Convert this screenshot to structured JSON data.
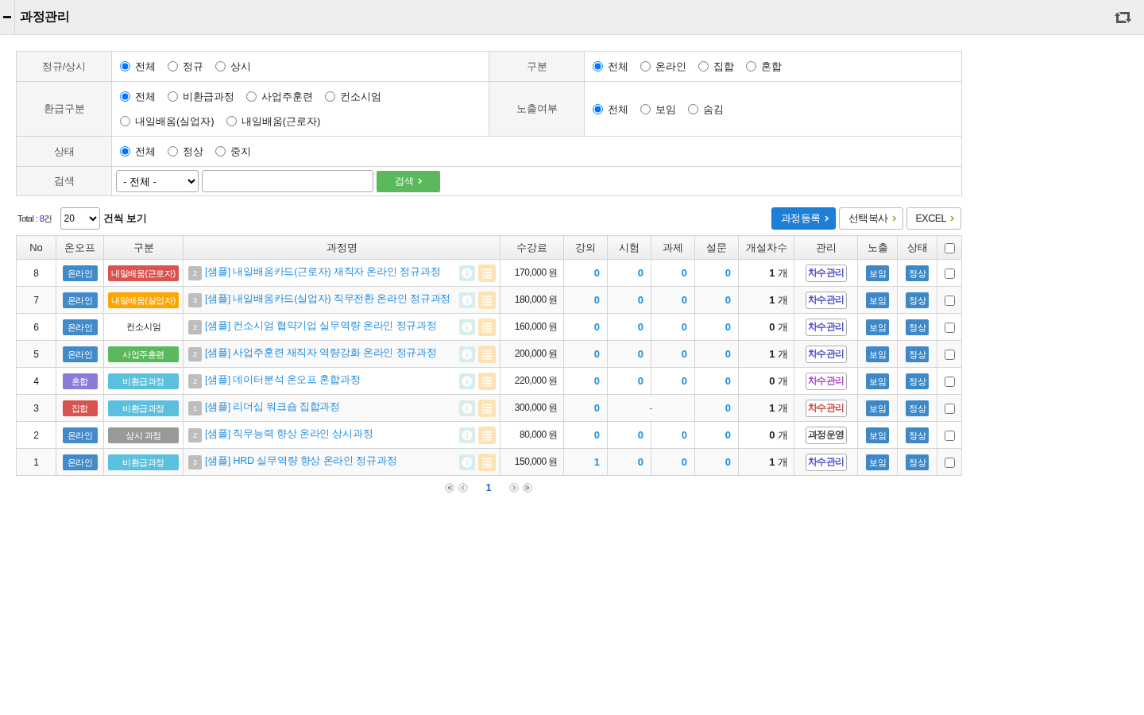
{
  "header": {
    "title": "과정관리"
  },
  "filter_rows": [
    {
      "groups": [
        {
          "label": "정규/상시",
          "options": [
            {
              "label": "전체",
              "selected": true
            },
            {
              "label": "정규",
              "selected": false
            },
            {
              "label": "상시",
              "selected": false
            }
          ]
        },
        {
          "label": "구분",
          "options": [
            {
              "label": "전체",
              "selected": true
            },
            {
              "label": "온라인",
              "selected": false
            },
            {
              "label": "집합",
              "selected": false
            },
            {
              "label": "혼합",
              "selected": false
            }
          ]
        }
      ]
    },
    {
      "groups": [
        {
          "label": "환급구분",
          "options": [
            {
              "label": "전체",
              "selected": true
            },
            {
              "label": "비환급과정",
              "selected": false
            },
            {
              "label": "사업주훈련",
              "selected": false
            },
            {
              "label": "컨소시엄",
              "selected": false
            },
            {
              "label": "내일배움(실업자)",
              "selected": false
            },
            {
              "label": "내일배움(근로자)",
              "selected": false
            }
          ]
        },
        {
          "label": "노출여부",
          "options": [
            {
              "label": "전체",
              "selected": true
            },
            {
              "label": "보임",
              "selected": false
            },
            {
              "label": "숨김",
              "selected": false
            }
          ]
        }
      ]
    },
    {
      "groups": [
        {
          "label": "상태",
          "options": [
            {
              "label": "전체",
              "selected": true
            },
            {
              "label": "정상",
              "selected": false
            },
            {
              "label": "중지",
              "selected": false
            }
          ]
        }
      ]
    }
  ],
  "search": {
    "label": "검색",
    "scope": "- 전체 -",
    "button": "검색"
  },
  "toolbar": {
    "total_label": "Total :",
    "total_count": "8",
    "total_unit": "건",
    "page_size": "20",
    "page_size_label": "건씩 보기",
    "buttons": [
      {
        "label": "과정등록",
        "kind": "primary"
      },
      {
        "label": "선택복사",
        "kind": "default"
      },
      {
        "label": "EXCEL",
        "kind": "default"
      }
    ]
  },
  "table": {
    "columns": [
      "No",
      "온오프",
      "구분",
      "과정명",
      "수강료",
      "강의",
      "시험",
      "과제",
      "설문",
      "개설차수",
      "관리",
      "노출",
      "상태"
    ],
    "all_checked": false,
    "rows": [
      {
        "no": "8",
        "mode": {
          "label": "온라인",
          "color": "#428bca"
        },
        "category": {
          "label": "내일배움(근로자)",
          "kind": "tag",
          "color": "#d9534f"
        },
        "round": "2",
        "name": "[샘플] 내일배움카드(근로자) 재직자 온라인 정규과정",
        "fee": "170,000 원",
        "exam_assignment_merged": false,
        "counts": [
          "0",
          "0",
          "0",
          "0"
        ],
        "sessions": "**1** 개",
        "manage": {
          "label": "차수관리",
          "color": "#4040c0"
        },
        "visibility": "보임",
        "status": "정상",
        "checked": false
      },
      {
        "no": "7",
        "mode": {
          "label": "온라인",
          "color": "#428bca"
        },
        "category": {
          "label": "내일배움(실업자)",
          "kind": "tag",
          "color": "#ffa500"
        },
        "round": "3",
        "name": "[샘플] 내일배움카드(실업자) 직무전환 온라인 정규과정",
        "fee": "180,000 원",
        "exam_assignment_merged": false,
        "counts": [
          "0",
          "0",
          "0",
          "0"
        ],
        "sessions": "**1** 개",
        "manage": {
          "label": "차수관리",
          "color": "#4040c0"
        },
        "visibility": "보임",
        "status": "정상",
        "checked": false
      },
      {
        "no": "6",
        "mode": {
          "label": "온라인",
          "color": "#428bca"
        },
        "category": {
          "label": "컨소시엄",
          "kind": "text"
        },
        "round": "2",
        "name": "[샘플] 컨소시엄 협약기업 실무역량 온라인 정규과정",
        "fee": "160,000 원",
        "exam_assignment_merged": false,
        "counts": [
          "0",
          "0",
          "0",
          "0"
        ],
        "sessions": "**0** 개",
        "manage": {
          "label": "차수관리",
          "color": "#4040c0"
        },
        "visibility": "보임",
        "status": "정상",
        "checked": false
      },
      {
        "no": "5",
        "mode": {
          "label": "온라인",
          "color": "#428bca"
        },
        "category": {
          "label": "사업주훈련",
          "kind": "tag",
          "color": "#5cb85c"
        },
        "round": "2",
        "name": "[샘플] 사업주훈련 재직자 역량강화 온라인 정규과정",
        "fee": "200,000 원",
        "exam_assignment_merged": false,
        "counts": [
          "0",
          "0",
          "0",
          "0"
        ],
        "sessions": "**1** 개",
        "manage": {
          "label": "차수관리",
          "color": "#4040c0"
        },
        "visibility": "보임",
        "status": "정상",
        "checked": false
      },
      {
        "no": "4",
        "mode": {
          "label": "혼합",
          "color": "#8a7bd9"
        },
        "category": {
          "label": "비환급과정",
          "kind": "tag",
          "color": "#5bc0de"
        },
        "round": "2",
        "name": "[샘플] 데이터분석 온오프 혼합과정",
        "fee": "220,000 원",
        "exam_assignment_merged": false,
        "counts": [
          "0",
          "0",
          "0",
          "0"
        ],
        "sessions": "**0** 개",
        "manage": {
          "label": "차수관리",
          "color": "#a040c0"
        },
        "visibility": "보임",
        "status": "정상",
        "checked": false
      },
      {
        "no": "3",
        "mode": {
          "label": "집합",
          "color": "#d9534f"
        },
        "category": {
          "label": "비환급과정",
          "kind": "tag",
          "color": "#5bc0de"
        },
        "round": "1",
        "name": "[샘플] 리더십 워크숍 집합과정",
        "fee": "300,000 원",
        "exam_assignment_merged": true,
        "counts": [
          "0",
          "-",
          "0"
        ],
        "sessions": "**1** 개",
        "manage": {
          "label": "차수관리",
          "color": "#c0392b"
        },
        "visibility": "보임",
        "status": "정상",
        "checked": false
      },
      {
        "no": "2",
        "mode": {
          "label": "온라인",
          "color": "#428bca"
        },
        "category": {
          "label": "상시 과정",
          "kind": "tag",
          "color": "#999999"
        },
        "round": "2",
        "name": "[샘플] 직무능력 향상 온라인 상시과정",
        "fee": "80,000 원",
        "exam_assignment_merged": false,
        "counts": [
          "0",
          "0",
          "0",
          "0"
        ],
        "sessions": "**0** 개",
        "manage": {
          "label": "과정운영",
          "color": "#333333"
        },
        "visibility": "보임",
        "status": "정상",
        "checked": false
      },
      {
        "no": "1",
        "mode": {
          "label": "온라인",
          "color": "#428bca"
        },
        "category": {
          "label": "비환급과정",
          "kind": "tag",
          "color": "#5bc0de"
        },
        "round": "3",
        "name": "[샘플] HRD 실무역량 향상 온라인 정규과정",
        "fee": "150,000 원",
        "exam_assignment_merged": false,
        "counts": [
          "1",
          "0",
          "0",
          "0"
        ],
        "sessions": "**1** 개",
        "manage": {
          "label": "차수관리",
          "color": "#4040c0"
        },
        "visibility": "보임",
        "status": "정상",
        "checked": false
      }
    ]
  },
  "pagination": {
    "pages": [
      {
        "label": "1",
        "selected": true
      }
    ]
  }
}
